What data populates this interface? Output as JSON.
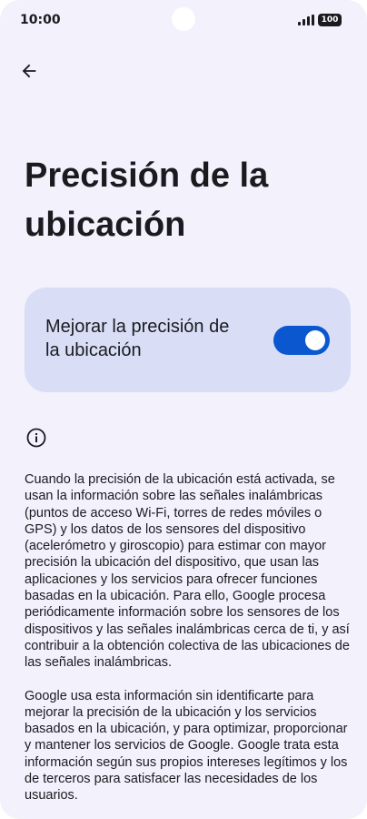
{
  "status_bar": {
    "time": "10:00",
    "battery": "100",
    "icons": [
      "signal-icon",
      "battery-icon"
    ]
  },
  "header": {
    "back_icon": "back-arrow-icon",
    "title": "Precisión de la ubicación"
  },
  "setting": {
    "label": "Mejorar la precisión de la ubicación",
    "enabled": true,
    "accent_color": "#0b57d0"
  },
  "info": {
    "icon": "info-icon",
    "paragraphs": [
      "Cuando la precisión de la ubicación está activada, se usan la información sobre las señales inalámbricas (puntos de acceso Wi-Fi, torres de redes móviles o GPS) y los datos de los sensores del dispositivo (acelerómetro y giroscopio) para estimar con mayor precisión la ubicación del dispositivo, que usan las aplicaciones y los servicios para ofrecer funciones basadas en la ubicación. Para ello, Google procesa periódicamente información sobre los sensores de los dispositivos y las señales inalámbricas cerca de ti, y así contribuir a la obtención colectiva de las ubicaciones de las señales inalámbricas.",
      "Google usa esta información sin identificarte para mejorar la precisión de la ubicación y los servicios basados en la ubicación, y para optimizar, proporcionar y mantener los servicios de Google. Google trata esta información según sus propios intereses legítimos y los de terceros para satisfacer las necesidades de los usuarios."
    ]
  }
}
